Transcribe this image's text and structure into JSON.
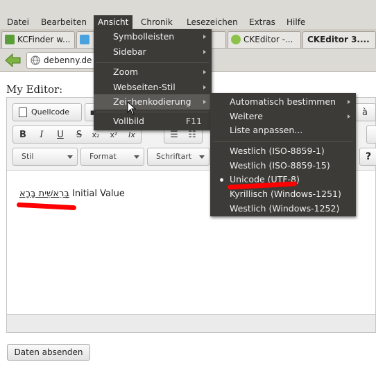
{
  "menubar": {
    "items": [
      "Datei",
      "Bearbeiten",
      "Ansicht",
      "Chronik",
      "Lesezeichen",
      "Extras",
      "Hilfe"
    ]
  },
  "tabs": [
    "KCFinder w...",
    "",
    "",
    "CKEditor -...",
    "CKEditor 3...."
  ],
  "urlbar": {
    "text": "debenny.de"
  },
  "page": {
    "editor_label": "My Editor:",
    "content_hebrew": "בְּרֵאשִׁית בָּרָא",
    "content_text": "Initial Value",
    "submit_label": "Daten absenden"
  },
  "editor_toolbar": {
    "source_label": "Quellcode",
    "format_buttons": [
      "B",
      "I",
      "U",
      "S",
      "x₂",
      "x²",
      "Ix"
    ],
    "combos": [
      "Stil",
      "Format",
      "Schriftart"
    ],
    "help_label": "?"
  },
  "ansicht_menu": {
    "items": [
      "Symbolleisten",
      "Sidebar",
      "Zoom",
      "Webseiten-Stil",
      "Zeichenkodierung",
      "Vollbild"
    ],
    "shortcut_vollbild": "F11"
  },
  "zeichenkodierung_menu": {
    "items": [
      "Automatisch bestimmen",
      "Weitere",
      "Liste anpassen...",
      "Westlich (ISO-8859-1)",
      "Westlich (ISO-8859-15)",
      "Unicode (UTF-8)",
      "Kyrillisch (Windows-1251)",
      "Westlich (Windows-1252)"
    ],
    "selected": "Unicode (UTF-8)"
  },
  "colors": {
    "menu_bg": "#3c3b37",
    "menu_highlight": "#5b5a56",
    "annotation_red": "#ff0000"
  }
}
